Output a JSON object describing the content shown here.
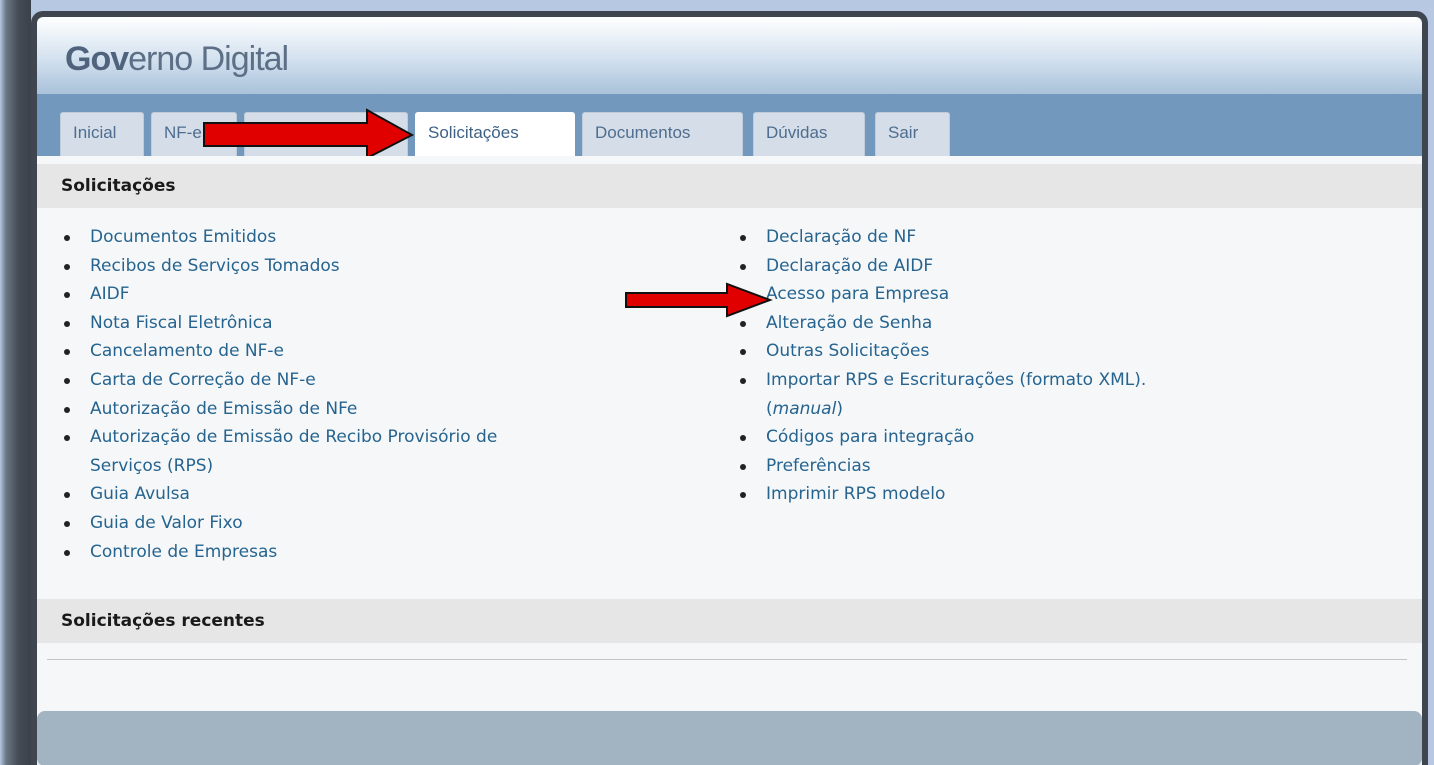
{
  "app": {
    "logo_bold": "Gov",
    "logo_rest": "erno Digital"
  },
  "tabs": [
    {
      "label": "Inicial"
    },
    {
      "label": "NF-e"
    },
    {
      "label": "Solicitações",
      "active": true
    },
    {
      "label": "Documentos"
    },
    {
      "label": "Dúvidas"
    },
    {
      "label": "Sair"
    }
  ],
  "solicitacoes": {
    "title": "Solicitações",
    "left_links": [
      "Documentos Emitidos",
      "Recibos de Serviços Tomados",
      "AIDF",
      "Nota Fiscal Eletrônica",
      "Cancelamento de NF-e",
      "Carta de Correção de NF-e",
      "Autorização de Emissão de NFe",
      "Autorização de Emissão de Recibo Provisório de",
      "Serviços (RPS)",
      "Guia Avulsa",
      "Guia de Valor Fixo",
      "Controle de Empresas"
    ],
    "right_links": [
      "Declaração de NF",
      "Declaração de AIDF",
      "Acesso para Empresa",
      "Alteração de Senha",
      "Outras Solicitações",
      "Importar RPS e Escriturações (formato XML).",
      "(",
      "manual",
      ")",
      "Códigos para integração",
      "Preferências",
      "Imprimir RPS modelo"
    ]
  },
  "recentes": {
    "title": "Solicitações recentes"
  },
  "colors": {
    "tab_bar": "#7299bd",
    "link": "#26648f",
    "arrow_red": "#e00000"
  }
}
